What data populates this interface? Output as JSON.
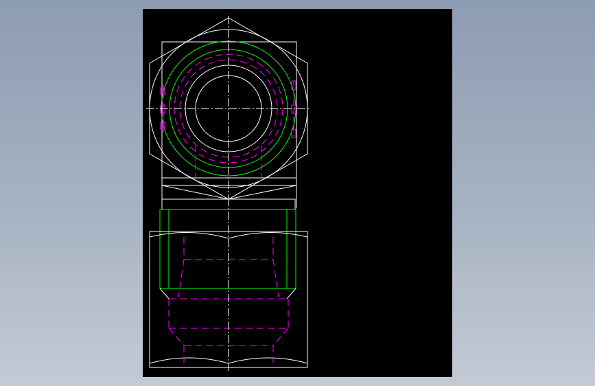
{
  "drawing": {
    "background": "#000000",
    "colors": {
      "outline": "#ffffff",
      "hidden": "#ff00ff",
      "thread": "#00ff00"
    },
    "views": [
      "top-view",
      "front-view"
    ]
  }
}
